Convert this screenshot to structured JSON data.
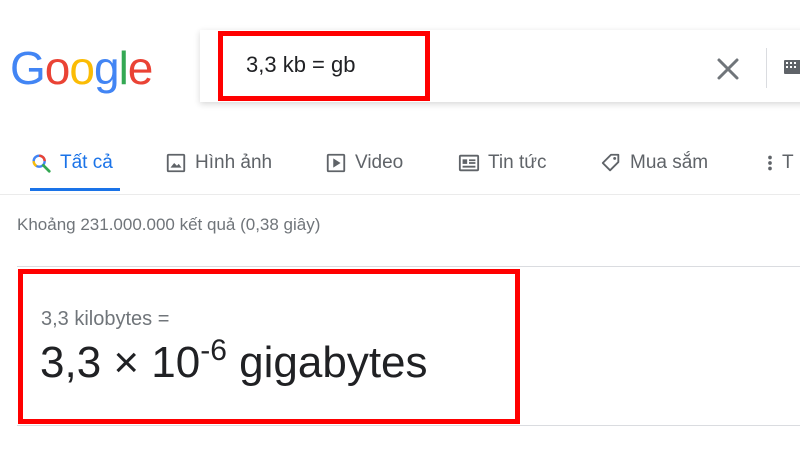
{
  "logo": {
    "text": "Google",
    "letters": [
      "G",
      "o",
      "o",
      "g",
      "l",
      "e"
    ]
  },
  "search": {
    "query": "3,3 kb = gb"
  },
  "icons": {
    "clear": "close-icon",
    "keyboard": "keyboard-icon"
  },
  "tabs": [
    {
      "label": "Tất cả",
      "icon": "search-icon",
      "active": true
    },
    {
      "label": "Hình ảnh",
      "icon": "image-icon"
    },
    {
      "label": "Video",
      "icon": "video-icon"
    },
    {
      "label": "Tin tức",
      "icon": "news-icon"
    },
    {
      "label": "Mua sắm",
      "icon": "tag-icon"
    },
    {
      "label": "T",
      "icon": "more-icon"
    }
  ],
  "results": {
    "stats": "Khoảng 231.000.000 kết quả (0,38 giây)"
  },
  "conversion": {
    "lhs": "3,3 kilobytes =",
    "rhs_base": "3,3 × 10",
    "rhs_exponent": "-6",
    "rhs_unit": " gigabytes"
  },
  "colors": {
    "google_blue": "#4285F4",
    "google_red": "#EA4335",
    "google_yellow": "#FBBC05",
    "google_green": "#34A853",
    "active_tab": "#1a73e8",
    "highlight": "#ff0000"
  }
}
